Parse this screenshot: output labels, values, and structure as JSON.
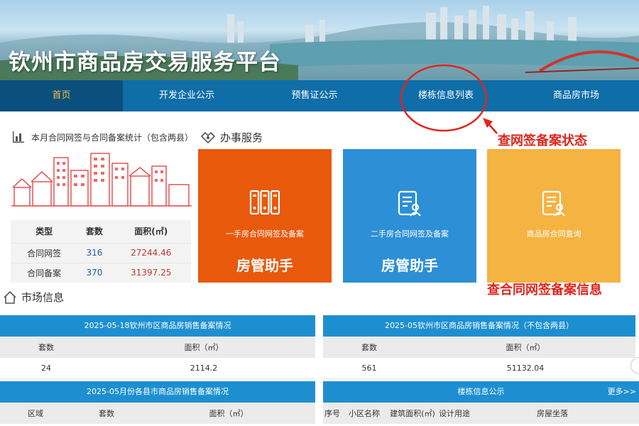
{
  "header": {
    "title": "钦州市商品房交易服务平台"
  },
  "nav": [
    {
      "label": "首页",
      "active": true
    },
    {
      "label": "开发企业公示",
      "active": false
    },
    {
      "label": "预售证公示",
      "active": false
    },
    {
      "label": "楼栋信息列表",
      "active": false
    },
    {
      "label": "商品房市场",
      "active": false
    }
  ],
  "stats": {
    "title": "本月合同网签与合同备案统计（包含两县）",
    "columns": [
      "类型",
      "套数",
      "面积(㎡)"
    ],
    "rows": [
      {
        "type": "合同网签",
        "count": "316",
        "area": "27244.46"
      },
      {
        "type": "合同备案",
        "count": "370",
        "area": "31397.25"
      }
    ]
  },
  "service": {
    "title": "办事服务",
    "cards": [
      {
        "sub": "一手房合同网签及备案",
        "main": "房管助手",
        "icon": "binders-icon"
      },
      {
        "sub": "二手房合同网签及备案",
        "main": "房管助手",
        "icon": "document-user-icon"
      },
      {
        "sub": "商品房合同查询",
        "main": "",
        "icon": "document-user-icon"
      }
    ]
  },
  "annotations": {
    "status": "查网签备案状态",
    "contract": "查合同网签备案信息",
    "color": "#e0251b"
  },
  "market": {
    "title": "市场信息",
    "tables": [
      {
        "title": "2025-05-18钦州市区商品房销售备案情况",
        "columns": [
          "套数",
          "面积（㎡）"
        ],
        "rows": [
          [
            "24",
            "2114.2"
          ]
        ]
      },
      {
        "title": "2025-05钦州市区商品房销售备案情况（不包含两县）",
        "columns": [
          "套数",
          "面积（㎡）"
        ],
        "rows": [
          [
            "561",
            "51132.04"
          ]
        ]
      },
      {
        "title": "2025-05月份各县市商品房销售备案情况",
        "columns": [
          "区域",
          "套数",
          "面积（㎡）"
        ],
        "rows": []
      },
      {
        "title": "楼栋信息公示",
        "more": "更多>>",
        "columns": [
          "序号",
          "小区名称",
          "建筑面积(㎡)",
          "设计用途",
          "房屋坐落"
        ],
        "rows": []
      }
    ]
  },
  "colors": {
    "nav": "#0f6da8",
    "nav_active": "#0a4f7e",
    "accent_gold": "#f4c23c",
    "table_header": "#1d8fd0",
    "card_orange": "#e8590c",
    "card_blue": "#2d8fd5",
    "card_yellow": "#f5b342"
  }
}
